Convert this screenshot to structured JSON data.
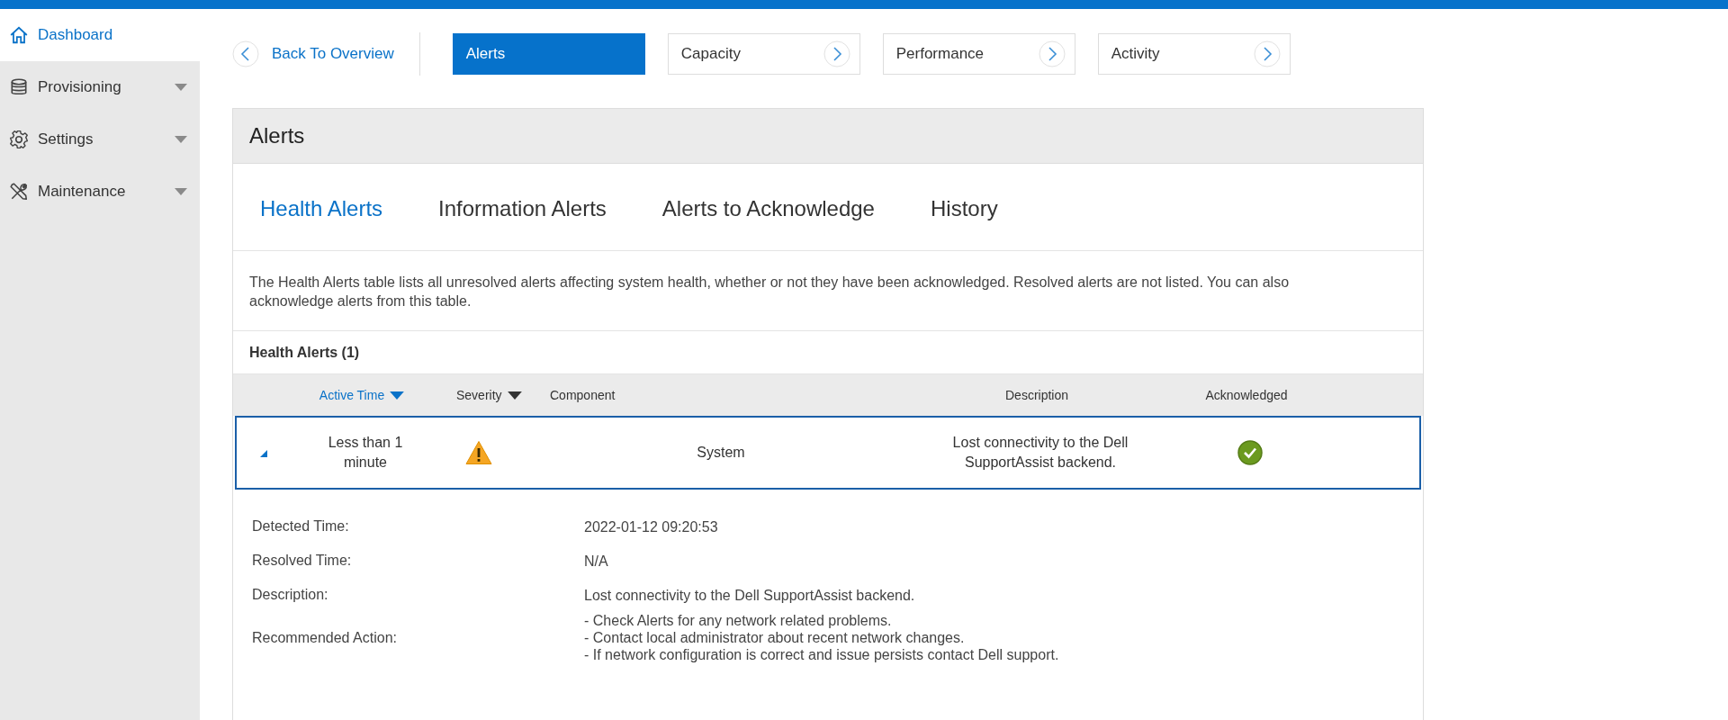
{
  "sidebar": {
    "items": [
      {
        "label": "Dashboard",
        "kind": "link",
        "selected": true
      },
      {
        "label": "Provisioning",
        "kind": "menu",
        "selected": false
      },
      {
        "label": "Settings",
        "kind": "menu",
        "selected": false
      },
      {
        "label": "Maintenance",
        "kind": "menu",
        "selected": false
      }
    ]
  },
  "nav": {
    "back": "Back To Overview",
    "tabs": [
      {
        "label": "Alerts",
        "selected": true
      },
      {
        "label": "Capacity",
        "selected": false
      },
      {
        "label": "Performance",
        "selected": false
      },
      {
        "label": "Activity",
        "selected": false
      }
    ]
  },
  "panel": {
    "title": "Alerts",
    "tabs": [
      {
        "label": "Health Alerts",
        "selected": true
      },
      {
        "label": "Information Alerts",
        "selected": false
      },
      {
        "label": "Alerts to Acknowledge",
        "selected": false
      },
      {
        "label": "History",
        "selected": false
      }
    ],
    "description": "The Health Alerts table lists all unresolved alerts affecting system health, whether or not they have been acknowledged. Resolved alerts are not listed. You can also acknowledge alerts from this table.",
    "table": {
      "title": "Health Alerts (1)",
      "columns": [
        {
          "label": "Active Time",
          "kind": "sortable",
          "selected": true
        },
        {
          "label": "Severity",
          "kind": "sortable",
          "selected": false
        },
        {
          "label": "Component",
          "kind": "plain",
          "selected": false
        },
        {
          "label": "Description",
          "kind": "plain",
          "selected": false
        },
        {
          "label": "Acknowledged",
          "kind": "plain",
          "selected": false
        }
      ],
      "rows": [
        {
          "active_time": "Less than 1 minute",
          "component": "System",
          "description": "Lost connectivity to the Dell SupportAssist backend.",
          "acknowledged": true,
          "expanded": true,
          "selected": true
        }
      ]
    },
    "details": [
      {
        "label": "Detected Time:",
        "lines": [
          "2022-01-12 09:20:53"
        ]
      },
      {
        "label": "Resolved Time:",
        "lines": [
          "N/A"
        ]
      },
      {
        "label": "Description:",
        "lines": [
          "Lost connectivity to the Dell SupportAssist backend."
        ]
      },
      {
        "label": "Recommended Action:",
        "lines": [
          "- Check Alerts for any network related problems.",
          "- Contact local administrator about recent network changes.",
          "- If network configuration is correct and issue persists contact Dell support."
        ]
      }
    ]
  }
}
